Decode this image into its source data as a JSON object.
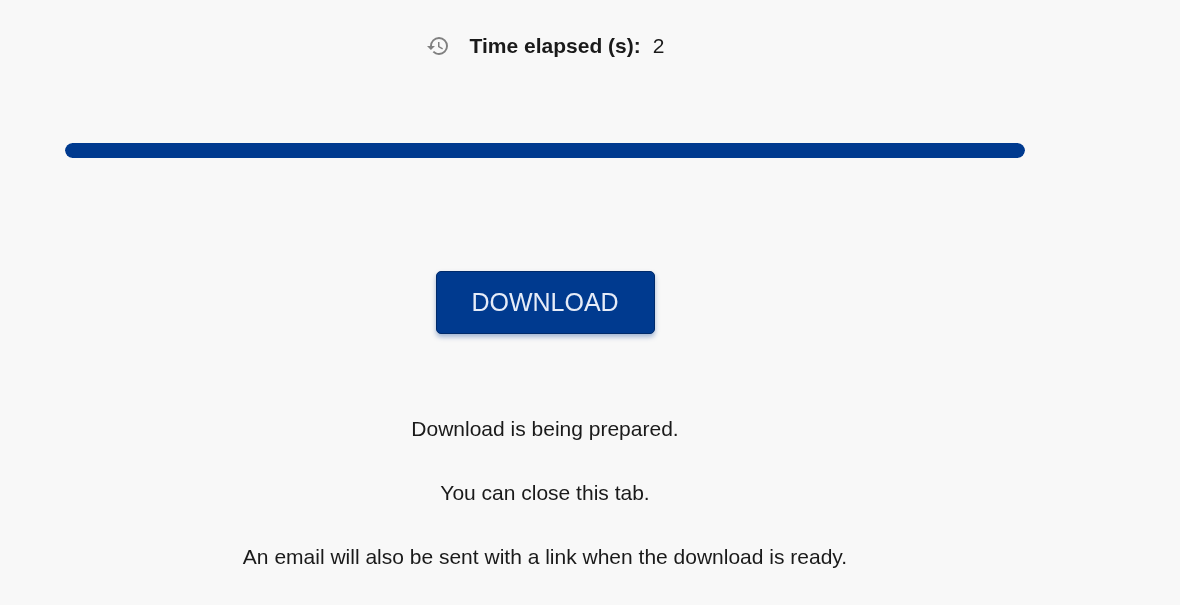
{
  "timer": {
    "label": "Time elapsed (s):",
    "value": "2"
  },
  "progress": {
    "level": 1
  },
  "download_button": {
    "label": "DOWNLOAD",
    "disabled": false
  },
  "messages": [
    "Download is being prepared.",
    "You can close this tab.",
    "An email will also be sent with a link when the download is ready."
  ]
}
